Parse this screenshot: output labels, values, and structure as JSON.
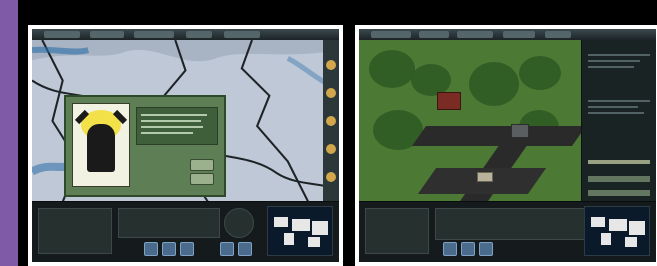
{
  "images": [
    {
      "label": "",
      "view": "strategic-map-with-event-dialog"
    },
    {
      "label": "",
      "view": "isometric-base-view"
    }
  ],
  "colors": {
    "background": "#000000",
    "accent_strip": "#7f5aa6",
    "frame": "#ffffff",
    "map_sea": "#9aa7b9",
    "dialog_green": "#5e7f56",
    "terrain_green": "#4c7a34",
    "ui_dark": "#151b1d"
  },
  "icons": {
    "minimap": "world-minimap-icon",
    "sidebar_buttons": [
      "round-button-icon",
      "round-button-icon",
      "round-button-icon",
      "round-button-icon",
      "round-button-icon"
    ],
    "portrait": "leader-portrait-icon"
  }
}
